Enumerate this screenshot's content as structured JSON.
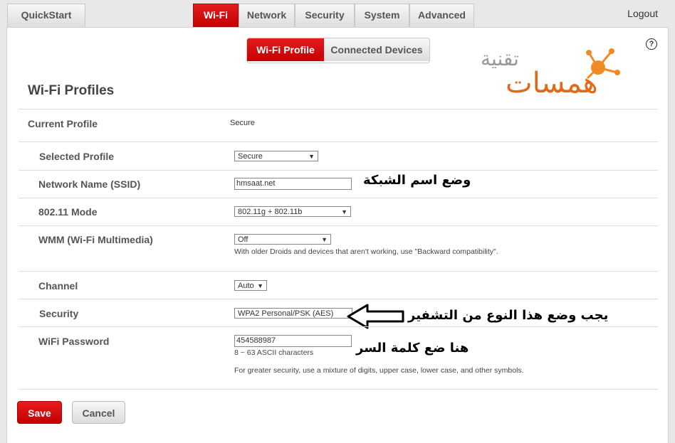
{
  "top_tabs": [
    "QuickStart",
    "Wi-Fi",
    "Network",
    "Security",
    "System",
    "Advanced"
  ],
  "logout": "Logout",
  "sub_tabs": [
    "Wi-Fi Profile",
    "Connected Devices"
  ],
  "help": "?",
  "logo": {
    "line1": "تقنية",
    "line2": "همسات"
  },
  "page_title": "Wi-Fi Profiles",
  "current_profile": {
    "label": "Current Profile",
    "value": "Secure"
  },
  "selected_profile": {
    "label": "Selected Profile",
    "value": "Secure"
  },
  "ssid": {
    "label": "Network Name (SSID)",
    "value": "hmsaat.net",
    "annotation": "وضع اسم الشبكة"
  },
  "mode": {
    "label": "802.11 Mode",
    "value": "802.11g + 802.11b"
  },
  "wmm": {
    "label": "WMM (Wi-Fi Multimedia)",
    "value": "Off",
    "hint": "With older Droids and devices that aren't working, use \"Backward compatibility\"."
  },
  "channel": {
    "label": "Channel",
    "value": "Auto"
  },
  "security": {
    "label": "Security",
    "value": "WPA2 Personal/PSK (AES)",
    "annotation": "يجب وضع هذا النوع من التشفير"
  },
  "password": {
    "label": "WiFi Password",
    "value": "454588987",
    "hint1": "8 ~ 63 ASCII characters",
    "hint2": "For greater security, use a mixture of digits, upper case, lower case, and other symbols.",
    "annotation": "هنا ضع كلمة السر"
  },
  "buttons": {
    "save": "Save",
    "cancel": "Cancel"
  },
  "colors": {
    "accent": "#d00000",
    "logo_orange": "#e06a1a"
  },
  "icons": [
    "help-icon",
    "dropdown-arrow-icon",
    "left-arrow-annotation"
  ]
}
